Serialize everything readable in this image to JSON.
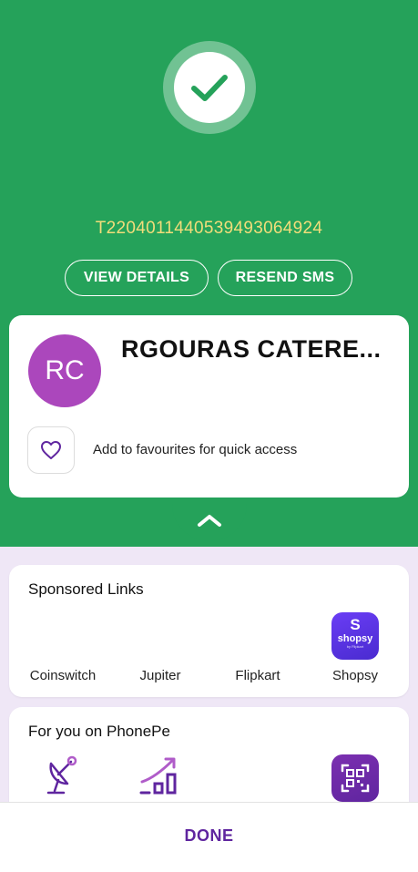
{
  "status": {
    "transaction_id": "T2204011440539493064924",
    "view_details_label": "VIEW DETAILS",
    "resend_sms_label": "RESEND SMS"
  },
  "merchant": {
    "initials": "RC",
    "name": "RGOURAS CATERE...",
    "favourite_text": "Add to favourites for quick access"
  },
  "sponsored": {
    "title": "Sponsored Links",
    "items": [
      {
        "label": "Coinswitch"
      },
      {
        "label": "Jupiter"
      },
      {
        "label": "Flipkart"
      },
      {
        "label": "Shopsy",
        "logo_text": "S",
        "logo_word": "shopsy",
        "logo_sub": "by Flipkart"
      }
    ]
  },
  "for_you": {
    "title": "For you on PhonePe",
    "icons": [
      "satellite-dish-icon",
      "growth-chart-icon",
      "qr-scanner-icon"
    ]
  },
  "footer": {
    "done_label": "DONE"
  },
  "colors": {
    "success_green": "#25a25a",
    "txn_id_yellow": "#f2dd7a",
    "avatar_purple": "#ab47bc",
    "phonepe_purple": "#5f259f",
    "page_lavender": "#efe7f6"
  }
}
